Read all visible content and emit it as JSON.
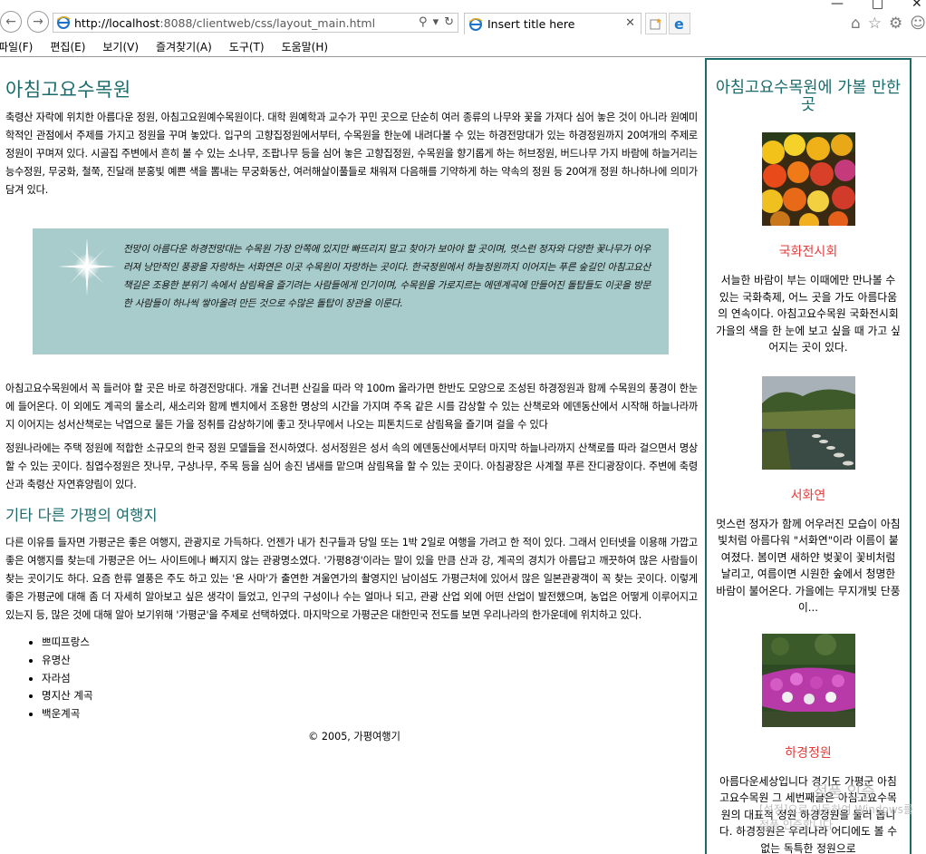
{
  "browser": {
    "url_host": "http://localhost",
    "url_rest": ":8088/clientweb/css/layout_main.html",
    "tab_title": "Insert title here",
    "menu": [
      "파일(F)",
      "편집(E)",
      "보기(V)",
      "즐겨찾기(A)",
      "도구(T)",
      "도움말(H)"
    ],
    "icons": [
      "back-arrow-icon",
      "forward-arrow-icon",
      "search-icon",
      "refresh-icon",
      "close-icon",
      "home-icon",
      "star-icon",
      "gear-icon"
    ]
  },
  "main": {
    "title": "아침고요수목원",
    "para1": "축령산 자락에 위치한 아름다운 정원, 아침고요원예수목원이다. 대학 원예학과 교수가 꾸민 곳으로 단순히 여러 종류의 나무와 꽃을 가져다 심어 놓은 것이 아니라 원예미학적인 관점에서 주제를 가지고 정원을 꾸며 놓았다. 입구의 고향집정원에서부터, 수목원을 한눈에 내려다볼 수 있는 하경전망대가 있는 하경정원까지 20여개의 주제로 정원이 꾸며져 있다. 시골집 주변에서 흔히 볼 수 있는 소나무, 조팝나무 등을 심어 놓은 고향집정원, 수목원을 향기롭게 하는 허브정원, 버드나무 가지 바람에 하늘거리는 능수정원, 무궁화, 철쭉, 진달래 분홍빛 예쁜 색을 뽐내는 무궁화동산, 여러해살이풀들로 채워져 다음해를 기약하게 하는 약속의 정원 등 20여개 정원 하나하나에 의미가 담겨 있다.",
    "quote": "전망이 아름다운 하경전망대는 수목원 가장 안쪽에 있지만 빠뜨리지 말고 찾아가 보아야 할 곳이며, 멋스런 정자와 다양한 꽃나무가 어우러져 낭만적인 풍광을 자랑하는 서화연은 이곳 수목원이 자랑하는 곳이다. 한국정원에서 하늘정원까지 이어지는 푸른 숲길인 아침고요산책길은 조용한 분위기 속에서 삼림욕을 즐기려는 사람들에게 인기이며, 수목원을 가로지르는 에덴계곡에 만들어진 돌탑들도 이곳을 방문한 사람들이 하나씩 쌓아올려 만든 것으로 수많은 돌탑이 장관을 이룬다.",
    "para2": "아침고요수목원에서 꼭 들러야 할 곳은 바로 하경전망대다. 개울 건너편 산길을 따라 약 100m 올라가면 한반도 모양으로 조성된 하경정원과 함께 수목원의 풍경이 한눈에 들어온다. 이 외에도 계곡의 물소리, 새소리와 함께 벤치에서 조용한 명상의 시간을 가지며 주옥 같은 시를 감상할 수 있는 산책로와 에덴동산에서 시작해 하늘나라까지 이어지는 성서산책로는 낙엽으로 물든 가을 정취를 감상하기에 좋고 잣나무에서 나오는 피톤치드로 삼림욕을 즐기며 걸을 수 있다",
    "para3": "정원나라에는 주택 정원에 적합한 소규모의 한국 정원 모델들을 전시하였다. 성서정원은 성서 속의 에덴동산에서부터 마지막 하늘나라까지 산책로를 따라 걸으면서 명상할 수 있는 곳이다. 침엽수정원은 잣나무, 구상나무, 주목 등을 심어 송진 냄새를 맡으며 삼림욕을 할 수 있는 곳이다. 아침광장은 사계절 푸른 잔디광장이다. 주변에 축령산과 축령산 자연휴양림이 있다.",
    "section_title": "기타 다른 가평의 여행지",
    "para4": "다른 이유를 들자면 가평군은 좋은 여행지, 관광지로 가득하다. 언젠가 내가 친구들과 당일 또는 1박 2일로 여행을 가려고 한 적이 있다. 그래서 인터넷을 이용해 가깝고 좋은 여행지를 찾는데 가평군은 어느 사이트에나 빠지지 않는 관광명소였다. '가평8경'이라는 말이 있을 만큼 산과 강, 계곡의 경치가 아름답고 깨끗하여 많은 사람들이 찾는 곳이기도 하다. 요즘 한류 열풍은 주도 하고 있는 '욘 사마'가 출연한 겨울연가의 촬영지인 남이섬도 가평근처에 있어서 많은 일본관광객이 꼭 찾는 곳이다. 이렇게 좋은 가평군에 대해 좀 더 자세히 알아보고 싶은 생각이 들었고, 인구의 구성이나 수는 얼마나 되고, 관광 산업 외에 어떤 산업이 발전했으며, 농업은 어떻게 이루어지고 있는지 등, 많은 것에 대해 알아 보기위해 '가평군'을 주제로 선택하였다. 마지막으로 가평군은 대한민국 전도를 보면 우리나라의 한가운데에 위치하고 있다.",
    "destinations": [
      "쁘띠프랑스",
      "유명산",
      "자라섬",
      "명지산 계곡",
      "백운계곡"
    ],
    "footer": "© 2005, 가평여행기"
  },
  "sidebar": {
    "title": "아침고요수목원에 가볼 만한 곳",
    "items": [
      {
        "name": "국화전시회",
        "desc": "서늘한 바람이 부는 이때에만 만나볼 수 있는 국화축제, 어느 곳을 가도 아름다움의 연속이다. 아침고요수목원 국화전시회가을의 색을 한 눈에 보고 싶을 때 가고 싶어지는 곳이 있다.",
        "photo": "chrysanthemum-photo"
      },
      {
        "name": "서화연",
        "desc": "멋스런 정자가 함께 어우러진 모습이 아침빛처럼 아름다워 \"서화연\"이라 이름이 붙여졌다. 봄이면 새하얀 벚꽃이 꽃비처럼 날리고, 여름이면 시원한 숲에서 청명한 바람이 불어온다. 가을에는 무지개빛 단풍이...",
        "photo": "pond-photo"
      },
      {
        "name": "하경정원",
        "desc": "아름다운세상입니다 경기도 가평군 아침고요수목원 그 세번째글은 아침고요수목원의 대표적 정원 하경정원을 둘러 봅니다. 하경정원은 우리나라 어디에도 볼 수 없는 독특한 정원으로",
        "photo": "flowerbed-photo"
      }
    ]
  },
  "watermark": {
    "line1": "정품 인증",
    "line2": "[설정]으로 이동하여 Windows를 정품 인증합니다."
  },
  "colors": {
    "heading": "#1b6b6b",
    "quote_bg": "#a8cccc",
    "sidebar_item_title": "#e53b3b"
  }
}
